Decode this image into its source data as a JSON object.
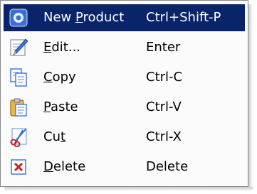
{
  "menu": {
    "items": [
      {
        "label_pre": "New ",
        "label_key": "P",
        "label_post": "roduct",
        "shortcut": "Ctrl+Shift-P",
        "icon": "new-product-icon",
        "selected": true
      },
      {
        "label_pre": "",
        "label_key": "E",
        "label_post": "dit...",
        "shortcut": "Enter",
        "icon": "edit-icon",
        "selected": false
      },
      {
        "label_pre": "",
        "label_key": "C",
        "label_post": "opy",
        "shortcut": "Ctrl-C",
        "icon": "copy-icon",
        "selected": false
      },
      {
        "label_pre": "",
        "label_key": "P",
        "label_post": "aste",
        "shortcut": "Ctrl-V",
        "icon": "paste-icon",
        "selected": false
      },
      {
        "label_pre": "Cu",
        "label_key": "t",
        "label_post": "",
        "shortcut": "Ctrl-X",
        "icon": "cut-icon",
        "selected": false
      },
      {
        "label_pre": "",
        "label_key": "D",
        "label_post": "elete",
        "shortcut": "Delete",
        "icon": "delete-icon",
        "selected": false
      }
    ]
  },
  "colors": {
    "selection_background": "#0a246a",
    "selection_text": "#ffffff",
    "menu_background": "#fbfbfb",
    "delete_icon_red": "#cc2222"
  }
}
